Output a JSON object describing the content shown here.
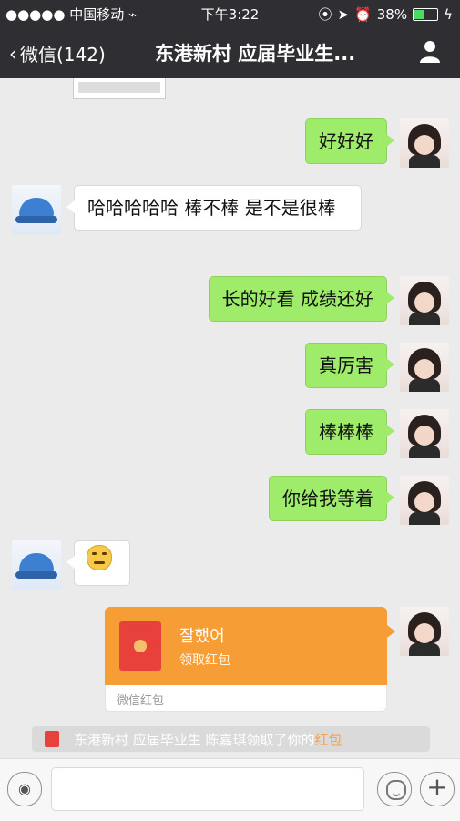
{
  "status_bar": {
    "signal": "●●●●●",
    "carrier": "中国移动",
    "wifi_icon": "wifi-icon",
    "time": "下午3:22",
    "battery": "38%"
  },
  "nav": {
    "back_label": "微信(142)",
    "title": "东港新村 应届毕业生...",
    "profile_icon": "person-icon"
  },
  "messages": [
    {
      "side": "out",
      "text": "好好好"
    },
    {
      "side": "in",
      "text": "哈哈哈哈哈  棒不棒  是不是很棒"
    },
    {
      "side": "out",
      "text": "长的好看 成绩还好"
    },
    {
      "side": "out",
      "text": "真厉害"
    },
    {
      "side": "out",
      "text": "棒棒棒"
    },
    {
      "side": "out",
      "text": "你给我等着"
    },
    {
      "side": "in",
      "emoji": "smile-emoji"
    }
  ],
  "red_packet": {
    "title": "잘했어",
    "subtitle": "领取红包",
    "footer": "微信红包"
  },
  "system_message": {
    "text": "东港新村 应届毕业生 陈嘉琪领取了你的",
    "link": "红包"
  },
  "input_bar": {
    "voice_icon": "voice-icon",
    "emoji_icon": "emoji-icon",
    "plus_icon": "plus-icon",
    "text": ""
  },
  "colors": {
    "nav": "#2f2f33",
    "chat_bg": "#ebebeb",
    "bubble_out": "#9feb6a",
    "bubble_in": "#ffffff",
    "red_packet": "#f79d35",
    "link": "#f4a24c"
  }
}
